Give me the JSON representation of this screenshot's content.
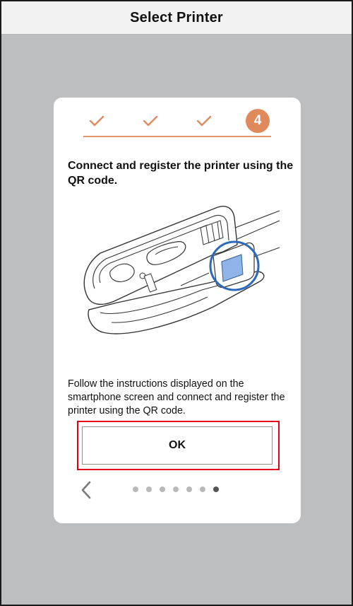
{
  "navbar": {
    "title": "Select Printer"
  },
  "steps": {
    "items": [
      {
        "state": "done",
        "icon": "check-icon"
      },
      {
        "state": "done",
        "icon": "check-icon"
      },
      {
        "state": "done",
        "icon": "check-icon"
      },
      {
        "state": "current",
        "label": "4"
      }
    ],
    "accent_color": "#e08a5c"
  },
  "card": {
    "heading": "Connect and register the printer using the QR code.",
    "illustration_icon": "printer-qr-illustration",
    "instructions": "Follow the instructions displayed on the smartphone screen and connect and register the printer using the QR code.",
    "ok_label": "OK",
    "highlight_color": "#e3001b"
  },
  "pager": {
    "total": 7,
    "current_index": 6,
    "back_icon": "chevron-left-icon"
  }
}
